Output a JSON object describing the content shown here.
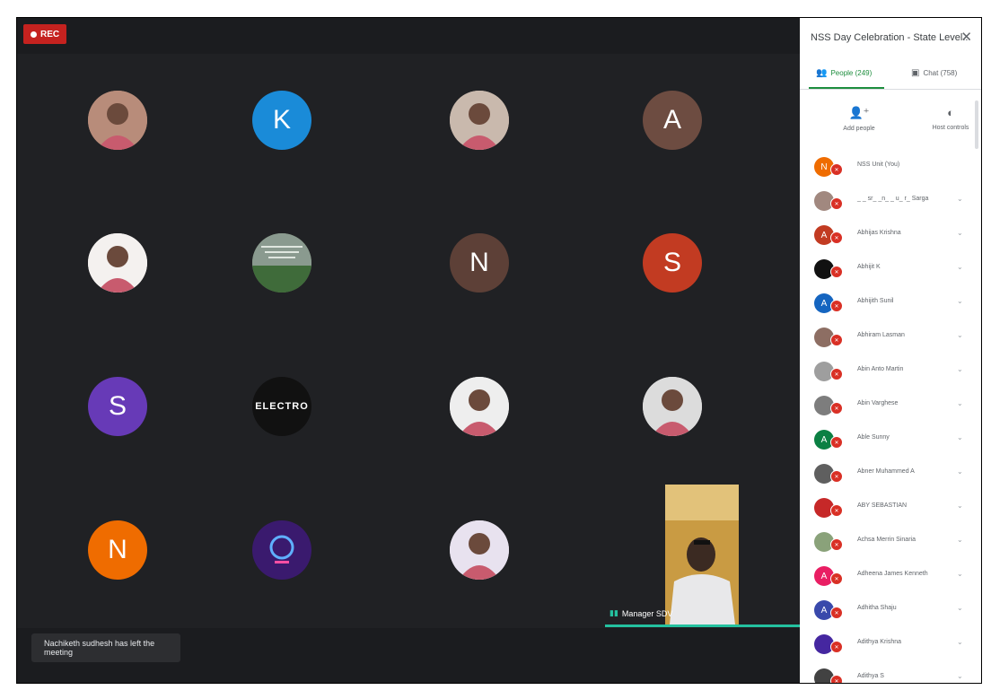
{
  "recording": {
    "label": "REC",
    "color": "#c5221f"
  },
  "grid_tiles": [
    {
      "id": "t1",
      "kind": "photo",
      "icon": "photo-avatar",
      "bg": "#b88c7a"
    },
    {
      "id": "t2",
      "kind": "letter",
      "letter": "K",
      "bg": "#1a8bd8"
    },
    {
      "id": "t3",
      "kind": "photo",
      "icon": "photo-avatar",
      "bg": "#c9b9ad"
    },
    {
      "id": "t4",
      "kind": "letter",
      "letter": "A",
      "bg": "#6d4c41"
    },
    {
      "id": "t5",
      "kind": "photo",
      "icon": "photo-avatar",
      "bg": "#f4f1ef"
    },
    {
      "id": "t6",
      "kind": "photo",
      "icon": "landscape-image",
      "bg": "#6f8a64"
    },
    {
      "id": "t7",
      "kind": "letter",
      "letter": "N",
      "bg": "#5d4037"
    },
    {
      "id": "t8",
      "kind": "letter",
      "letter": "S",
      "bg": "#c23b22"
    },
    {
      "id": "t9",
      "kind": "letter",
      "letter": "S",
      "bg": "#673ab7"
    },
    {
      "id": "t10",
      "kind": "logo",
      "text": "ELECTRO",
      "bg": "#111111"
    },
    {
      "id": "t11",
      "kind": "photo",
      "icon": "photo-avatar",
      "bg": "#eeeeee"
    },
    {
      "id": "t12",
      "kind": "photo",
      "icon": "photo-avatar",
      "bg": "#dcdcdc"
    },
    {
      "id": "t13",
      "kind": "letter",
      "letter": "N",
      "bg": "#ef6c00"
    },
    {
      "id": "t14",
      "kind": "logo",
      "text": "",
      "bg": "#3a1a6e"
    },
    {
      "id": "t15",
      "kind": "photo",
      "icon": "photo-avatar",
      "bg": "#e8e2ef"
    }
  ],
  "active_speaker": {
    "name": "Manager SDV",
    "indicator_color": "#24c19f"
  },
  "toast": {
    "text": "Nachiketh sudhesh has left the meeting"
  },
  "panel": {
    "title": "NSS Day Celebration - State Level...",
    "close_icon": "close-icon",
    "tabs": [
      {
        "label": "People (249)",
        "icon": "people-icon",
        "active": true
      },
      {
        "label": "Chat (758)",
        "icon": "chat-icon",
        "active": false
      }
    ],
    "actions": [
      {
        "label": "Add people",
        "icon": "add-person-icon"
      },
      {
        "label": "Host controls",
        "icon": "toggle-icon"
      }
    ],
    "participants": [
      {
        "name": "NSS Unit (You)",
        "initial": "N",
        "color": "#ef6c00",
        "chevron": false
      },
      {
        "name": "_ _ sr_ _n_ _ u_ r_ Sarga",
        "initial": "",
        "color": "#a1887f",
        "chevron": true
      },
      {
        "name": "Abhijas Krishna",
        "initial": "A",
        "color": "#c23b22",
        "chevron": true
      },
      {
        "name": "Abhijit K",
        "initial": "",
        "color": "#111111",
        "chevron": true
      },
      {
        "name": "Abhijith Sunil",
        "initial": "A",
        "color": "#1565c0",
        "chevron": true
      },
      {
        "name": "Abhiram Lasman",
        "initial": "",
        "color": "#8d6e63",
        "chevron": true
      },
      {
        "name": "Abin Anto Martin",
        "initial": "",
        "color": "#9e9e9e",
        "chevron": true
      },
      {
        "name": "Abin Varghese",
        "initial": "",
        "color": "#7d7d7d",
        "chevron": true
      },
      {
        "name": "Able Sunny",
        "initial": "A",
        "color": "#0b8043",
        "chevron": true
      },
      {
        "name": "Abner Muhammed A",
        "initial": "",
        "color": "#5f5f5f",
        "chevron": true
      },
      {
        "name": "ABY SEBASTIAN",
        "initial": "",
        "color": "#c62828",
        "chevron": true
      },
      {
        "name": "Achsa Merrin Sinaria",
        "initial": "",
        "color": "#8aa27a",
        "chevron": true
      },
      {
        "name": "Adheena James Kenneth",
        "initial": "A",
        "color": "#e91e63",
        "chevron": true
      },
      {
        "name": "Adhitha Shaju",
        "initial": "A",
        "color": "#3949ab",
        "chevron": true
      },
      {
        "name": "Adithya Krishna",
        "initial": "",
        "color": "#4527a0",
        "chevron": true
      },
      {
        "name": "Adithya S",
        "initial": "",
        "color": "#424242",
        "chevron": true
      }
    ]
  }
}
